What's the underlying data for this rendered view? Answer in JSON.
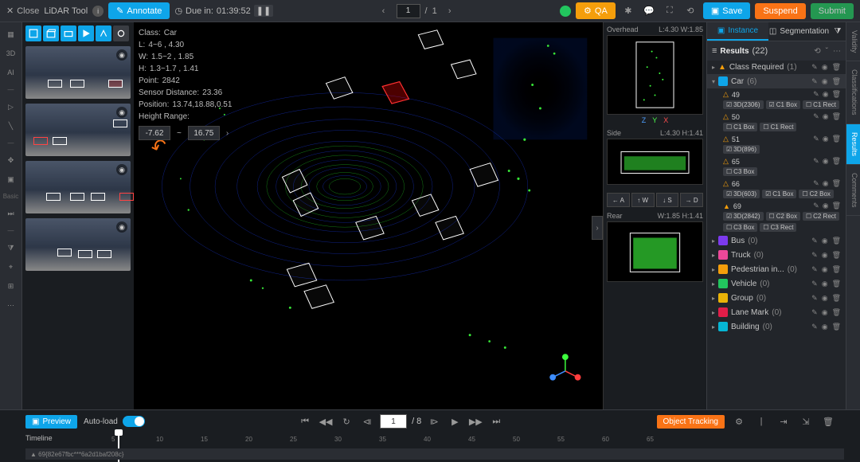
{
  "header": {
    "close": "Close",
    "tool_name": "LiDAR Tool",
    "annotate_label": "Annotate",
    "due_label": "Due in:",
    "due_time": "01:39:52",
    "page_current": "1",
    "page_sep": "/",
    "page_total": "1",
    "qa_label": "QA",
    "save_label": "Save",
    "suspend_label": "Suspend",
    "submit_label": "Submit"
  },
  "left_rail": {
    "items_top": [
      "3D",
      "AI"
    ],
    "section": "Basic"
  },
  "info": {
    "class_k": "Class:",
    "class_v": "Car",
    "l_k": "L:",
    "l_v": "4~6 , 4.30",
    "w_k": "W:",
    "w_v": "1.5~2 , 1.85",
    "h_k": "H:",
    "h_v": "1.3~1.7 , 1.41",
    "point_k": "Point:",
    "point_v": "2842",
    "sensor_k": "Sensor Distance:",
    "sensor_v": "23.36",
    "pos_k": "Position:",
    "pos_v": "13.74,18.88,0.51",
    "hr_label": "Height Range:",
    "hr_min": "-7.62",
    "hr_sep": "~",
    "hr_max": "16.75"
  },
  "side_views": {
    "overhead": {
      "label": "Overhead",
      "meta": "L:4.30 W:1.85",
      "axes": [
        "Z",
        "Y",
        "X"
      ]
    },
    "side": {
      "label": "Side",
      "meta": "L:4.30 H:1.41"
    },
    "rear": {
      "label": "Rear",
      "meta": "W:1.85 H:1.41"
    },
    "nav": [
      "← A",
      "↑ W",
      "↓ S",
      "→ D"
    ]
  },
  "right_panel": {
    "tabs": {
      "instance": "Instance",
      "segmentation": "Segmentation"
    },
    "results_label": "Results",
    "results_count": "(22)",
    "categories": [
      {
        "name": "Class Required",
        "count": "(1)",
        "color": "#f59e0b",
        "expanded": false,
        "icon": "warn"
      },
      {
        "name": "Car",
        "count": "(6)",
        "color": "#0ea5e9",
        "expanded": true,
        "items": [
          {
            "id": "49",
            "tags": [
              {
                "t": "3D(2306)",
                "c": true
              },
              {
                "t": "C1 Box",
                "c": true
              },
              {
                "t": "C1 Rect",
                "c": false
              }
            ]
          },
          {
            "id": "50",
            "tags": [
              {
                "t": "C1 Box",
                "c": false
              },
              {
                "t": "C1 Rect",
                "c": false
              }
            ]
          },
          {
            "id": "51",
            "tags": [
              {
                "t": "3D(896)",
                "c": true
              }
            ]
          },
          {
            "id": "65",
            "tags": [
              {
                "t": "C3 Box",
                "c": false
              }
            ]
          },
          {
            "id": "66",
            "tags": [
              {
                "t": "3D(603)",
                "c": true
              },
              {
                "t": "C1 Box",
                "c": true
              },
              {
                "t": "C2 Box",
                "c": false
              }
            ]
          },
          {
            "id": "69",
            "warn": true,
            "tags": [
              {
                "t": "3D(2842)",
                "c": true
              },
              {
                "t": "C2 Box",
                "c": false
              },
              {
                "t": "C2 Rect",
                "c": false
              },
              {
                "t": "C3 Box",
                "c": false
              },
              {
                "t": "C3 Rect",
                "c": false
              }
            ]
          }
        ]
      },
      {
        "name": "Bus",
        "count": "(0)",
        "color": "#7c3aed"
      },
      {
        "name": "Truck",
        "count": "(0)",
        "color": "#ec4899"
      },
      {
        "name": "Pedestrian in...",
        "count": "(0)",
        "color": "#f59e0b"
      },
      {
        "name": "Vehicle",
        "count": "(0)",
        "color": "#22c55e"
      },
      {
        "name": "Group",
        "count": "(0)",
        "color": "#eab308"
      },
      {
        "name": "Lane Mark",
        "count": "(0)",
        "color": "#e11d48"
      },
      {
        "name": "Building",
        "count": "(0)",
        "color": "#06b6d4"
      }
    ]
  },
  "vert_tabs": [
    "Validity",
    "Classifications",
    "Results",
    "Comments"
  ],
  "bottom": {
    "preview": "Preview",
    "autoload": "Auto-load",
    "frame_current": "1",
    "frame_total": "/ 8",
    "object_tracking": "Object Tracking",
    "timeline_label": "Timeline",
    "track_id": "69{82e67fbc***6a2d1baf208c}",
    "ticks": [
      "5",
      "10",
      "15",
      "20",
      "25",
      "30",
      "35",
      "40",
      "45",
      "50",
      "55",
      "60",
      "65"
    ]
  }
}
